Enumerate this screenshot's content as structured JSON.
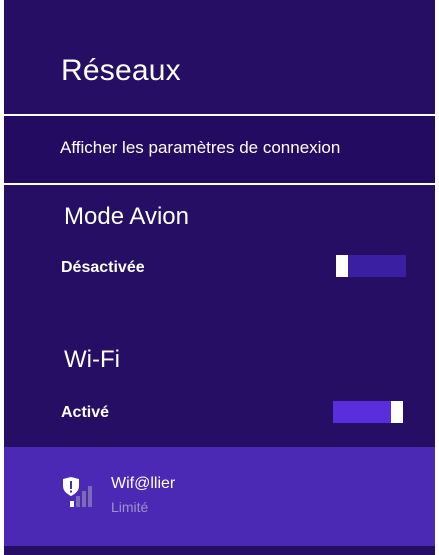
{
  "panel": {
    "title": "Réseaux",
    "settings_link": "Afficher les paramètres de connexion",
    "background": "#250e63"
  },
  "airplane_mode": {
    "label": "Mode Avion",
    "state_text": "Désactivée",
    "on": false
  },
  "wifi": {
    "label": "Wi-Fi",
    "state_text": "Activé",
    "on": true
  },
  "networks": [
    {
      "name": "Wif@llier",
      "status": "Limité",
      "icon": "wifi-signal-shield-warning-icon"
    }
  ]
}
